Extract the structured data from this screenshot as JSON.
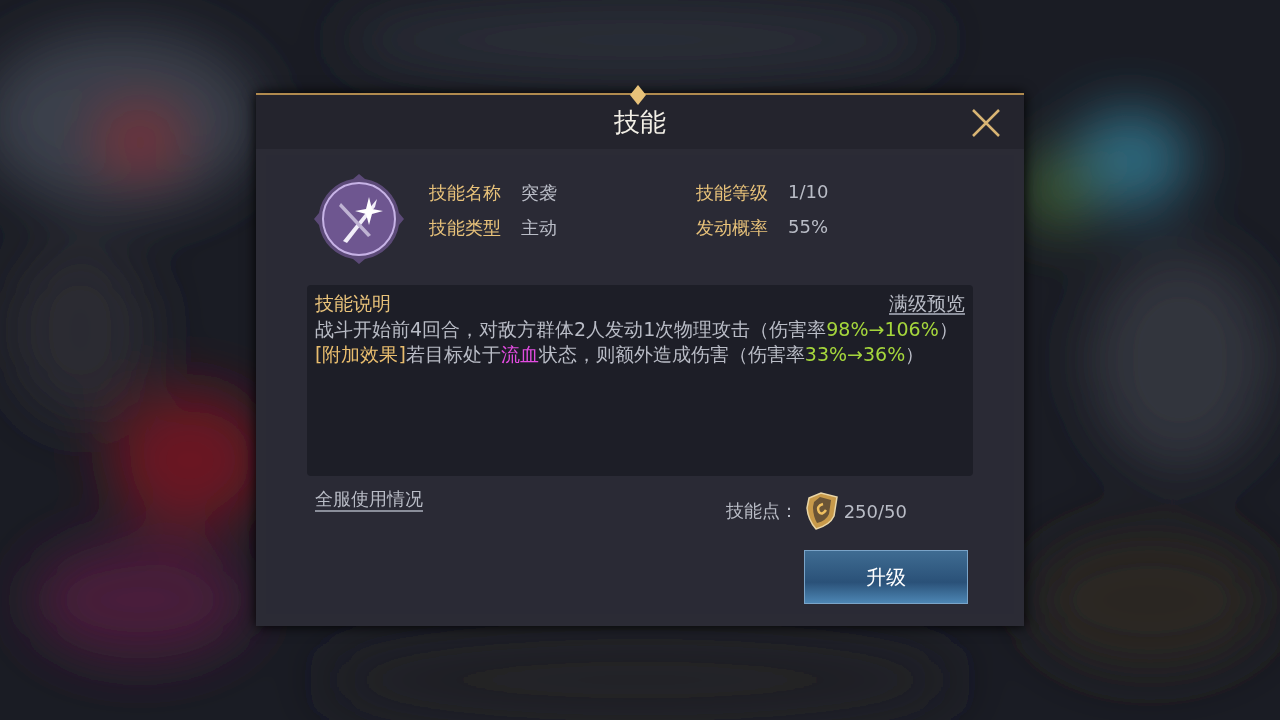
{
  "dialog": {
    "title": "技能"
  },
  "skill": {
    "fields": [
      {
        "label": "技能名称",
        "value": "突袭"
      },
      {
        "label": "技能等级",
        "value": "1/10"
      },
      {
        "label": "技能类型",
        "value": "主动"
      },
      {
        "label": "发动概率",
        "value": "55%"
      }
    ]
  },
  "description": {
    "title": "技能说明",
    "preview_link": "满级预览",
    "paragraphs": [
      [
        {
          "kind": "text",
          "text": "战斗开始前4回合，对敌方群体2人发动1次物理攻击（伤害率"
        },
        {
          "kind": "value",
          "text": "98%→106%"
        },
        {
          "kind": "text",
          "text": "）"
        }
      ],
      [
        {
          "kind": "tag",
          "text": "[附加效果]"
        },
        {
          "kind": "text",
          "text": "若目标处于"
        },
        {
          "kind": "status",
          "text": "流血"
        },
        {
          "kind": "text",
          "text": "状态，则额外造成伤害（伤害率"
        },
        {
          "kind": "value",
          "text": "33%→36%"
        },
        {
          "kind": "text",
          "text": "）"
        }
      ]
    ]
  },
  "usage_link": "全服使用情况",
  "skill_points": {
    "label": "技能点：",
    "value": "250/50"
  },
  "upgrade_button": "升级"
}
